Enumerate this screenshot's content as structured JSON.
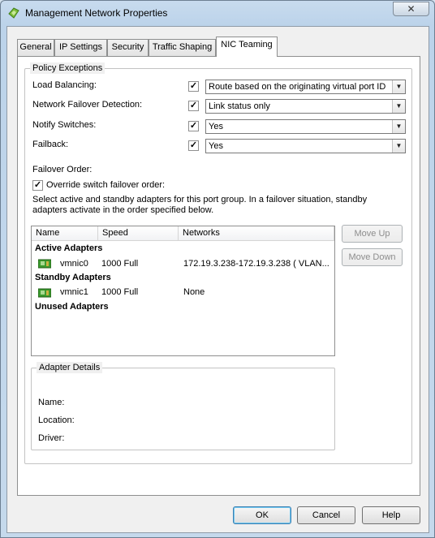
{
  "window": {
    "title": "Management Network Properties",
    "close_glyph": "✕"
  },
  "tabs": [
    {
      "label": "General"
    },
    {
      "label": "IP Settings"
    },
    {
      "label": "Security"
    },
    {
      "label": "Traffic Shaping"
    },
    {
      "label": "NIC Teaming",
      "active": true
    }
  ],
  "policy_exceptions": {
    "title": "Policy Exceptions",
    "rows": [
      {
        "label": "Load Balancing:",
        "checked": true,
        "value": "Route based on the originating virtual port ID"
      },
      {
        "label": "Network Failover Detection:",
        "checked": true,
        "value": "Link status only"
      },
      {
        "label": "Notify Switches:",
        "checked": true,
        "value": "Yes"
      },
      {
        "label": "Failback:",
        "checked": true,
        "value": "Yes"
      }
    ],
    "failover_order_label": "Failover Order:",
    "override_label": "Override switch failover order:",
    "override_checked": true,
    "description_line1": "Select active and standby adapters for this port group.  In a failover situation, standby",
    "description_line2": "adapters activate  in the order specified below."
  },
  "adapters": {
    "columns": [
      "Name",
      "Speed",
      "Networks"
    ],
    "active_title": "Active Adapters",
    "standby_title": "Standby Adapters",
    "unused_title": "Unused Adapters",
    "active": [
      {
        "name": "vmnic0",
        "speed": "1000 Full",
        "networks": "172.19.3.238-172.19.3.238 ( VLAN..."
      }
    ],
    "standby": [
      {
        "name": "vmnic1",
        "speed": "1000 Full",
        "networks": "None"
      }
    ],
    "move_up": "Move Up",
    "move_down": "Move Down"
  },
  "adapter_details": {
    "title": "Adapter Details",
    "name_label": "Name:",
    "location_label": "Location:",
    "driver_label": "Driver:"
  },
  "footer": {
    "ok": "OK",
    "cancel": "Cancel",
    "help": "Help"
  },
  "colors": {
    "title_bar": "#bcd3ea",
    "dialog_bg": "#f0f0f0",
    "nic_icon": "#3c9a2e"
  },
  "icons": {
    "app": "vsphere-logo-icon",
    "nic": "network-adapter-icon",
    "checkbox": "checkmark-icon"
  }
}
